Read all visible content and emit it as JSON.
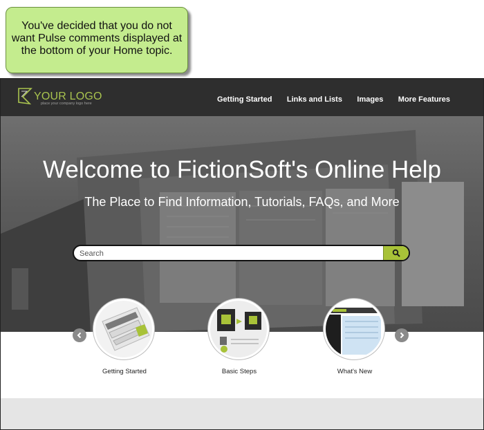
{
  "callout": {
    "text": "You've decided that you do not want Pulse comments displayed at the bottom of your Home topic."
  },
  "logo": {
    "title": "YOUR LOGO",
    "subtitle": "place your company logo here"
  },
  "nav": {
    "items": [
      {
        "label": "Getting Started"
      },
      {
        "label": "Links and Lists"
      },
      {
        "label": "Images"
      },
      {
        "label": "More Features"
      }
    ]
  },
  "hero": {
    "title": "Welcome to FictionSoft's Online Help",
    "subtitle": "The Place to Find Information, Tutorials, FAQs, and More"
  },
  "search": {
    "placeholder": "Search",
    "icon": "search-icon"
  },
  "tiles": [
    {
      "label": "Getting Started"
    },
    {
      "label": "Basic Steps"
    },
    {
      "label": "What's New"
    }
  ],
  "colors": {
    "accent": "#a8c238",
    "navbar": "#2e2e2e",
    "callout": "#c4ec8e"
  }
}
